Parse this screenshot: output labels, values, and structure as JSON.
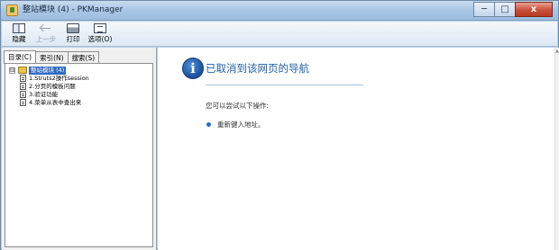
{
  "window": {
    "title": "整站模块 (4) - PKManager",
    "caption_buttons": {
      "minimize": "─",
      "maximize": "□",
      "close": "x"
    }
  },
  "toolbar": {
    "hide_label": "隐藏",
    "back_label": "上一步",
    "print_label": "打印",
    "options_label": "选项(O)"
  },
  "nav": {
    "tabs": [
      "目录(C)",
      "索引(N)",
      "搜索(S)"
    ],
    "root": {
      "expander": "⊟",
      "label": "整站模块 (4)"
    },
    "items": [
      "1.Struts2操作session",
      "2.分页的模板问题",
      "3.验证功能",
      "4.菜单从表中查出来"
    ]
  },
  "content": {
    "info_glyph": "i",
    "heading": "已取消到该网页的导航",
    "subheading": "您可以尝试以下操作:",
    "bullet": "重新键入地址。",
    "scroll_up_glyph": "▲"
  },
  "colors": {
    "heading": "#1f5fa8",
    "selection": "#316ac5",
    "info_icon": "#1c4f9a",
    "close_button": "#c9503a"
  }
}
